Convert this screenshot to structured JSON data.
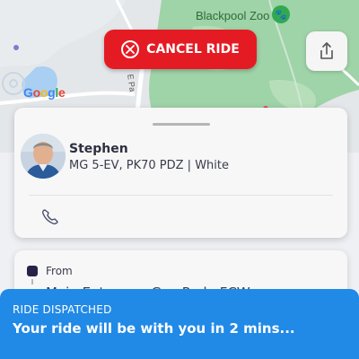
{
  "map": {
    "poi_label": "Blackpool Zoo",
    "poi_icon": "paw-icon",
    "road_label": "E Pa",
    "attribution": [
      "G",
      "o",
      "o",
      "g",
      "l",
      "e"
    ]
  },
  "actions": {
    "cancel_label": "CANCEL RIDE",
    "cancel_icon": "x-circle-icon",
    "cancel_color": "#e51b23",
    "share_icon": "share-icon"
  },
  "driver": {
    "name": "Stephen",
    "vehicle": "MG 5-EV, PK70 PDZ | White",
    "call_icon": "phone-icon"
  },
  "trip": {
    "from_label": "From",
    "from_address": "Main Entrance, Gay Park, FCW..."
  },
  "dispatch": {
    "status": "RIDE DISPATCHED",
    "message": "Your ride will be with you in 2 mins...",
    "color": "#2189e6"
  }
}
